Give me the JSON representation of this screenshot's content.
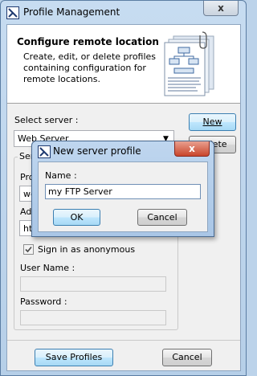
{
  "window": {
    "title": "Profile Management",
    "close_glyph": "x",
    "icon": "app-icon"
  },
  "header": {
    "title": "Configure remote location",
    "line1": "Create, edit, or delete profiles",
    "line2": "containing configuration for",
    "line3": "remote locations.",
    "illustration": "diagram-documents-illustration"
  },
  "server": {
    "label": "Select server :",
    "selected": "Web Server",
    "new_label": "New",
    "delete_label": "Delete",
    "group_label_fragment": "Ser",
    "protocol_label_fragment": "Pro",
    "protocol_value_fragment": "we",
    "address_label_fragment": "Ad",
    "address_value_fragment": "ht"
  },
  "auth": {
    "anonymous_label": "Sign in as anonymous",
    "anonymous_checked": true,
    "username_label": "User Name :",
    "username_value": "",
    "password_label": "Password :",
    "password_value": ""
  },
  "footer": {
    "save_label": "Save Profiles",
    "cancel_label": "Cancel"
  },
  "dialog": {
    "title": "New server profile",
    "close_glyph": "x",
    "name_label": "Name :",
    "name_value": "my FTP Server",
    "ok_label": "OK",
    "cancel_label": "Cancel"
  }
}
